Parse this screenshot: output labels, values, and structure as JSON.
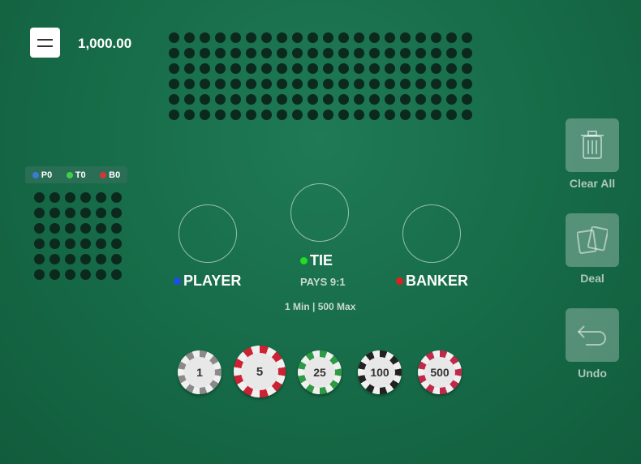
{
  "balance": "1,000.00",
  "stats": {
    "player": {
      "label": "P0",
      "color": "#3a7bd5"
    },
    "tie": {
      "label": "T0",
      "color": "#3fcf4a"
    },
    "banker": {
      "label": "B0",
      "color": "#d43636"
    }
  },
  "bets": {
    "player": {
      "label": "PLAYER",
      "color": "#1f4fe0"
    },
    "tie": {
      "label": "TIE",
      "color": "#22dd22",
      "pays": "PAYS 9:1"
    },
    "banker": {
      "label": "BANKER",
      "color": "#e02020"
    }
  },
  "limits": "1 Min | 500 Max",
  "chips": [
    {
      "value": "1",
      "color": "#8a8a8a"
    },
    {
      "value": "5",
      "color": "#cc2233"
    },
    {
      "value": "25",
      "color": "#2f9a45"
    },
    {
      "value": "100",
      "color": "#222222"
    },
    {
      "value": "500",
      "color": "#c02a4a"
    }
  ],
  "actions": {
    "clear_all": "Clear All",
    "deal": "Deal",
    "undo": "Undo"
  }
}
